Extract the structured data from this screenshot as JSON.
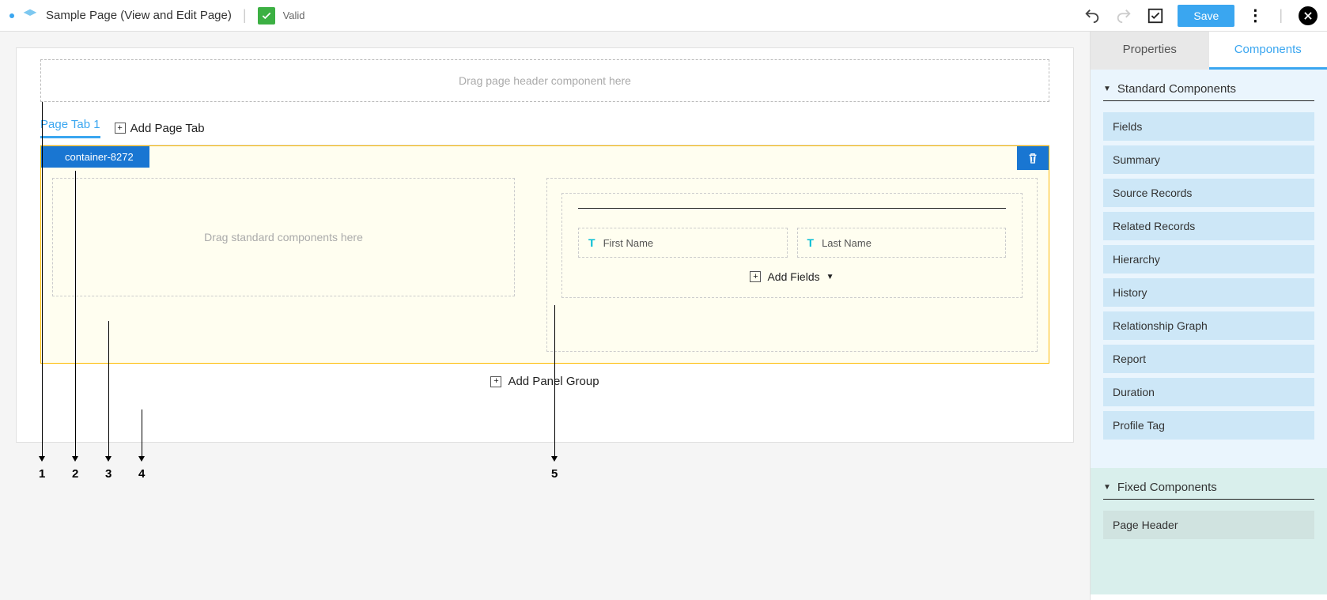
{
  "topbar": {
    "title": "Sample Page (View and Edit Page)",
    "valid_label": "Valid",
    "save_label": "Save"
  },
  "canvas": {
    "header_drop_text": "Drag page header component here",
    "page_tab_label": "Page Tab 1",
    "add_page_tab_label": "Add Page Tab",
    "container_label": "container-8272",
    "left_drop_text": "Drag standard components here",
    "fields": {
      "first": "First Name",
      "last": "Last Name"
    },
    "add_fields_label": "Add Fields",
    "add_panel_group_label": "Add Panel Group",
    "callout_labels": [
      "1",
      "2",
      "3",
      "4",
      "5"
    ]
  },
  "sidepanel": {
    "tab_properties": "Properties",
    "tab_components": "Components",
    "standard_header": "Standard Components",
    "fixed_header": "Fixed Components",
    "items": {
      "i0": "Fields",
      "i1": "Summary",
      "i2": "Source Records",
      "i3": "Related Records",
      "i4": "Hierarchy",
      "i5": "History",
      "i6": "Relationship Graph",
      "i7": "Report",
      "i8": "Duration",
      "i9": "Profile Tag"
    },
    "fixed_item": "Page Header"
  }
}
